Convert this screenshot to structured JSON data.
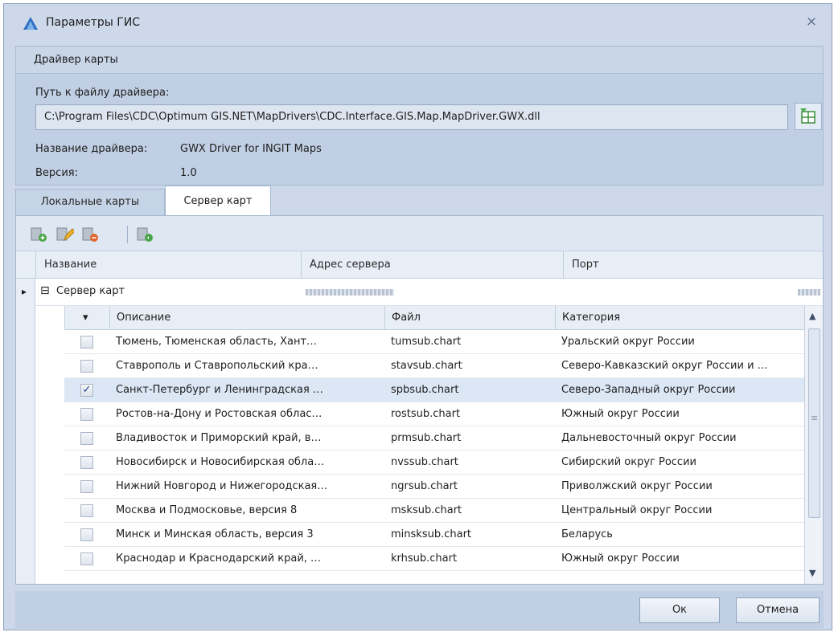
{
  "window": {
    "title": "Параметры ГИС",
    "close_icon": "×"
  },
  "driver": {
    "section_title": "Драйвер карты",
    "path_label": "Путь к файлу драйвера:",
    "path_value": "C:\\Program Files\\CDC\\Optimum GIS.NET\\MapDrivers\\CDC.Interface.GIS.Map.MapDriver.GWX.dll",
    "name_label": "Название драйвера:",
    "name_value": "GWX Driver for INGIT Maps",
    "version_label": "Версия:",
    "version_value": "1.0"
  },
  "tabs": [
    {
      "label": "Локальные карты",
      "active": false
    },
    {
      "label": "Сервер карт",
      "active": true
    }
  ],
  "toolbar": {
    "buttons": [
      {
        "icon": "add-server-icon"
      },
      {
        "icon": "edit-server-icon"
      },
      {
        "icon": "delete-server-icon"
      },
      {
        "icon": "refresh-server-icon"
      }
    ]
  },
  "master_grid": {
    "columns": [
      "Название",
      "Адрес сервера",
      "Порт"
    ],
    "row": {
      "expand_glyph": "⊟",
      "indicator": "▸",
      "name": "Сервер карт"
    }
  },
  "detail_grid": {
    "sort_glyph": "▾",
    "columns": [
      "Описание",
      "Файл",
      "Категория"
    ],
    "check_glyph": "✓",
    "rows": [
      {
        "checked": false,
        "description": "Тюмень, Тюменская область, Хант…",
        "file": "tumsub.chart",
        "category": "Уральский округ России"
      },
      {
        "checked": false,
        "description": "Ставрополь и Ставропольский кра…",
        "file": "stavsub.chart",
        "category": "Северо-Кавказский округ России и …"
      },
      {
        "checked": true,
        "description": "Санкт-Петербург и Ленинградская …",
        "file": "spbsub.chart",
        "category": "Северо-Западный округ России"
      },
      {
        "checked": false,
        "description": "Ростов-на-Дону и Ростовская облас…",
        "file": "rostsub.chart",
        "category": "Южный округ России"
      },
      {
        "checked": false,
        "description": "Владивосток и Приморский край, в…",
        "file": "prmsub.chart",
        "category": "Дальневосточный округ России"
      },
      {
        "checked": false,
        "description": "Новосибирск и Новосибирская обла…",
        "file": "nvssub.chart",
        "category": "Сибирский округ России"
      },
      {
        "checked": false,
        "description": "Нижний Новгород и Нижегородская…",
        "file": "ngrsub.chart",
        "category": "Приволжский округ России"
      },
      {
        "checked": false,
        "description": "Москва и Подмосковье, версия 8",
        "file": "msksub.chart",
        "category": "Центральный округ России"
      },
      {
        "checked": false,
        "description": "Минск и Минская область, версия 3",
        "file": "minsksub.chart",
        "category": "Беларусь"
      },
      {
        "checked": false,
        "description": "Краснодар и Краснодарский край, …",
        "file": "krhsub.chart",
        "category": "Южный округ России"
      }
    ],
    "scroll_up": "▲",
    "scroll_down": "▼",
    "scroll_grip": "≡"
  },
  "buttons": {
    "ok": "Ок",
    "cancel": "Отмена"
  },
  "colors": {
    "accent": "#2f6fc4",
    "selected_row": "#dce7f6",
    "chrome": "#cdd9ea"
  }
}
